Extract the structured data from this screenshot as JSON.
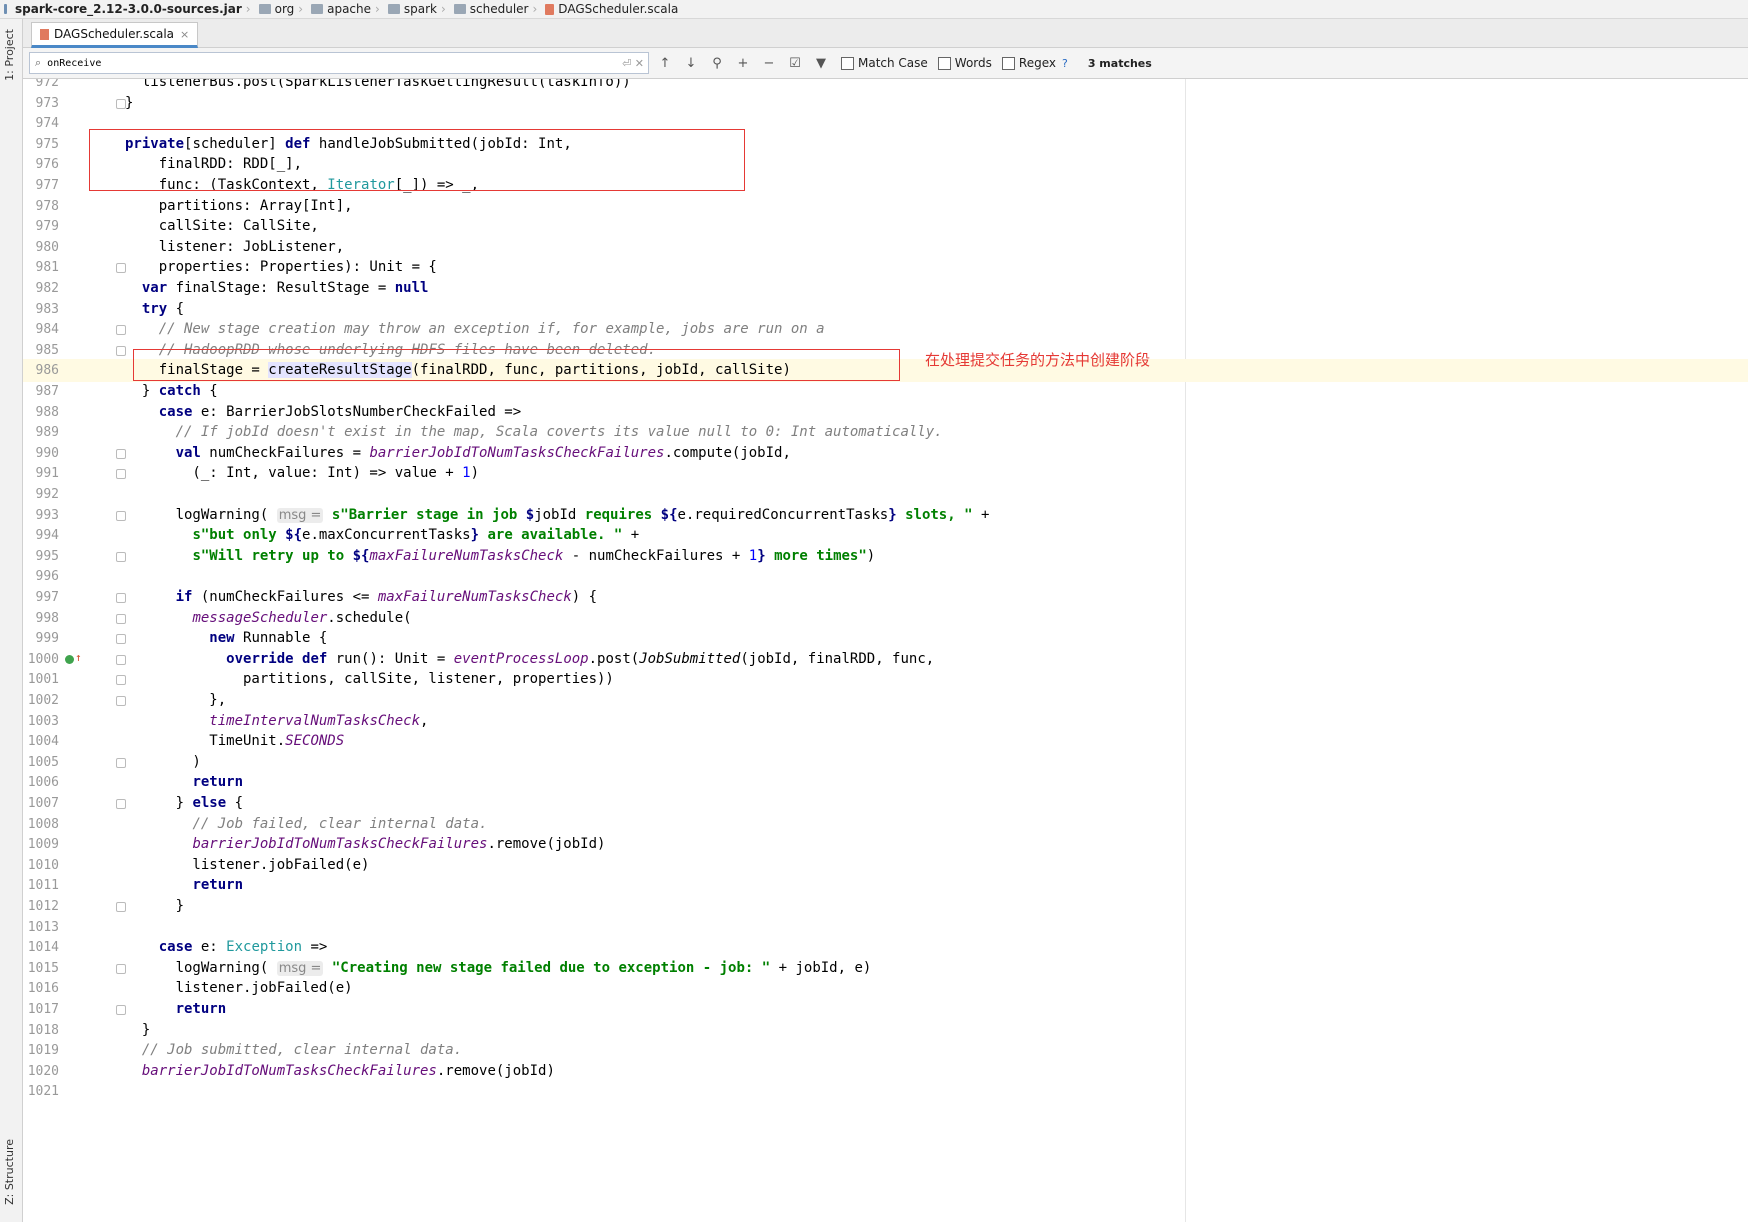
{
  "breadcrumb": [
    "spark-core_2.12-3.0.0-sources.jar",
    "org",
    "apache",
    "spark",
    "scheduler",
    "DAGScheduler.scala"
  ],
  "left_panel": {
    "project_label": "1: Project",
    "structure_label": "Z: Structure"
  },
  "tab": {
    "label": "DAGScheduler.scala",
    "close": "×"
  },
  "find": {
    "query": "onReceive",
    "match_case": "Match Case",
    "words": "Words",
    "regex": "Regex",
    "help": "?",
    "matches": "3 matches"
  },
  "annotation": "在处理提交任务的方法中创建阶段",
  "colors": {
    "highlight_box": "#e53935",
    "keyword": "#000080",
    "string": "#008000",
    "comment": "#808080",
    "field": "#660e7a"
  },
  "lines": [
    {
      "n": "972",
      "html": "  listenerBus.post(SparkListenerTaskGettingResult(taskInfo))",
      "fold": false
    },
    {
      "n": "973",
      "html": "}",
      "fold": true
    },
    {
      "n": "974",
      "html": "",
      "fold": false
    },
    {
      "n": "975",
      "html": "<span class=\"k\">private</span>[scheduler] <span class=\"k\">def</span> handleJobSubmitted(jobId: Int,",
      "fold": false
    },
    {
      "n": "976",
      "html": "    finalRDD: RDD[_],",
      "fold": false
    },
    {
      "n": "977",
      "html": "    func: (TaskContext, <span class=\"t\">Iterator</span>[_]) => _,",
      "fold": false
    },
    {
      "n": "978",
      "html": "    partitions: Array[Int],",
      "fold": false
    },
    {
      "n": "979",
      "html": "    callSite: CallSite,",
      "fold": false
    },
    {
      "n": "980",
      "html": "    listener: JobListener,",
      "fold": false
    },
    {
      "n": "981",
      "html": "    properties: Properties): Unit = {",
      "fold": true
    },
    {
      "n": "982",
      "html": "  <span class=\"k\">var</span> finalStage: ResultStage = <span class=\"k\">null</span>",
      "fold": false
    },
    {
      "n": "983",
      "html": "  <span class=\"k\">try</span> {",
      "fold": false
    },
    {
      "n": "984",
      "html": "    <span class=\"c\">// New stage creation may throw an exception if, for example, jobs are run on a</span>",
      "fold": true
    },
    {
      "n": "985",
      "html": "    <span class=\"c\">// HadoopRDD whose underlying HDFS files have been deleted.</span>",
      "fold": true
    },
    {
      "n": "986",
      "html": "    finalStage = <span class=\"hl\">createResultStage</span>(finalRDD, func, partitions, jobId, callSite)",
      "fold": false,
      "cur": true
    },
    {
      "n": "987",
      "html": "  } <span class=\"k\">catch</span> {",
      "fold": false
    },
    {
      "n": "988",
      "html": "    <span class=\"k\">case</span> e: BarrierJobSlotsNumberCheckFailed =>",
      "fold": false
    },
    {
      "n": "989",
      "html": "      <span class=\"c\">// If jobId doesn't exist in the map, Scala coverts its value null to 0: Int automatically.</span>",
      "fold": false
    },
    {
      "n": "990",
      "html": "      <span class=\"k\">val</span> numCheckFailures = <span class=\"f\">barrierJobIdToNumTasksCheckFailures</span>.compute(jobId,",
      "fold": true
    },
    {
      "n": "991",
      "html": "        (_: Int, value: Int) => value + <span class=\"n\">1</span>)",
      "fold": true
    },
    {
      "n": "992",
      "html": "",
      "fold": false
    },
    {
      "n": "993",
      "html": "      logWarning( <span class=\"hint\">msg =</span> <span class=\"s\">s\"Barrier stage in job </span><span class=\"k\">$</span>jobId<span class=\"s\"> requires </span><span class=\"k\">${</span>e.requiredConcurrentTasks<span class=\"k\">}</span><span class=\"s\"> slots, \"</span> +",
      "fold": true
    },
    {
      "n": "994",
      "html": "        <span class=\"s\">s\"but only </span><span class=\"k\">${</span>e.maxConcurrentTasks<span class=\"k\">}</span><span class=\"s\"> are available. \"</span> +",
      "fold": false
    },
    {
      "n": "995",
      "html": "        <span class=\"s\">s\"Will retry up to </span><span class=\"k\">${</span><span class=\"f\">maxFailureNumTasksCheck</span> - numCheckFailures + <span class=\"n\">1</span><span class=\"k\">}</span><span class=\"s\"> more times\"</span>)",
      "fold": true
    },
    {
      "n": "996",
      "html": "",
      "fold": false
    },
    {
      "n": "997",
      "html": "      <span class=\"k\">if</span> (numCheckFailures <= <span class=\"f\">maxFailureNumTasksCheck</span>) {",
      "fold": true
    },
    {
      "n": "998",
      "html": "        <span class=\"f\">messageScheduler</span>.schedule(",
      "fold": true
    },
    {
      "n": "999",
      "html": "          <span class=\"k\">new</span> Runnable {",
      "fold": true
    },
    {
      "n": "1000",
      "html": "            <span class=\"k\">override def</span> run(): Unit = <span class=\"f\">eventProcessLoop</span>.post(<i>JobSubmitted</i>(jobId, finalRDD, func,",
      "fold": true,
      "marker": true
    },
    {
      "n": "1001",
      "html": "              partitions, callSite, listener, properties))",
      "fold": true
    },
    {
      "n": "1002",
      "html": "          },",
      "fold": true
    },
    {
      "n": "1003",
      "html": "          <span class=\"f\">timeIntervalNumTasksCheck</span>,",
      "fold": false
    },
    {
      "n": "1004",
      "html": "          TimeUnit.<span class=\"f\">SECONDS</span>",
      "fold": false
    },
    {
      "n": "1005",
      "html": "        )",
      "fold": true
    },
    {
      "n": "1006",
      "html": "        <span class=\"k\">return</span>",
      "fold": false
    },
    {
      "n": "1007",
      "html": "      } <span class=\"k\">else</span> {",
      "fold": true
    },
    {
      "n": "1008",
      "html": "        <span class=\"c\">// Job failed, clear internal data.</span>",
      "fold": false
    },
    {
      "n": "1009",
      "html": "        <span class=\"f\">barrierJobIdToNumTasksCheckFailures</span>.remove(jobId)",
      "fold": false
    },
    {
      "n": "1010",
      "html": "        listener.jobFailed(e)",
      "fold": false
    },
    {
      "n": "1011",
      "html": "        <span class=\"k\">return</span>",
      "fold": false
    },
    {
      "n": "1012",
      "html": "      }",
      "fold": true
    },
    {
      "n": "1013",
      "html": "",
      "fold": false
    },
    {
      "n": "1014",
      "html": "    <span class=\"k\">case</span> e: <span class=\"t\">Exception</span> =>",
      "fold": false
    },
    {
      "n": "1015",
      "html": "      logWarning( <span class=\"hint\">msg =</span> <span class=\"s\">\"Creating new stage failed due to exception - job: \"</span> + jobId, e)",
      "fold": true
    },
    {
      "n": "1016",
      "html": "      listener.jobFailed(e)",
      "fold": false
    },
    {
      "n": "1017",
      "html": "      <span class=\"k\">return</span>",
      "fold": true
    },
    {
      "n": "1018",
      "html": "  }",
      "fold": false
    },
    {
      "n": "1019",
      "html": "  <span class=\"c\">// Job submitted, clear internal data.</span>",
      "fold": false
    },
    {
      "n": "1020",
      "html": "  <span class=\"f\">barrierJobIdToNumTasksCheckFailures</span>.remove(jobId)",
      "fold": false
    },
    {
      "n": "1021",
      "html": "",
      "fold": false
    }
  ]
}
